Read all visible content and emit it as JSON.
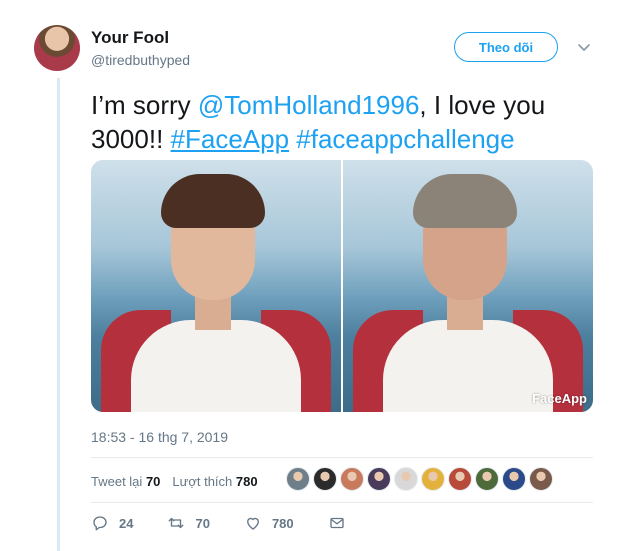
{
  "author": {
    "display_name": "Your Fool",
    "handle": "@tiredbuthyped"
  },
  "follow_button": {
    "label": "Theo dõi"
  },
  "tweet": {
    "text_prefix": "I’m sorry ",
    "mention": "@TomHolland1996",
    "text_middle": ", I love you 3000!! ",
    "hashtag1": "#FaceApp",
    "text_space": " ",
    "hashtag2": "#faceappchallenge",
    "watermark": "FaceApp",
    "timestamp": "18:53 - 16 thg 7, 2019"
  },
  "stats": {
    "retweets_label": "Tweet lại",
    "retweets_count": "70",
    "likes_label": "Lượt thích",
    "likes_count": "780"
  },
  "likers": [
    {
      "color": "#6f7f8a"
    },
    {
      "color": "#2b2b2b"
    },
    {
      "color": "#c97a5c"
    },
    {
      "color": "#4a3b5c"
    },
    {
      "color": "#d8d8d8"
    },
    {
      "color": "#e3b23c"
    },
    {
      "color": "#b84a3a"
    },
    {
      "color": "#4d6b3a"
    },
    {
      "color": "#2a4a8a"
    },
    {
      "color": "#7a5a4a"
    }
  ],
  "actions": {
    "reply_count": "24",
    "retweet_count": "70",
    "like_count": "780"
  },
  "colors": {
    "accent": "#1da1f2",
    "muted": "#657786",
    "thread_line": "#dbe9f5"
  }
}
